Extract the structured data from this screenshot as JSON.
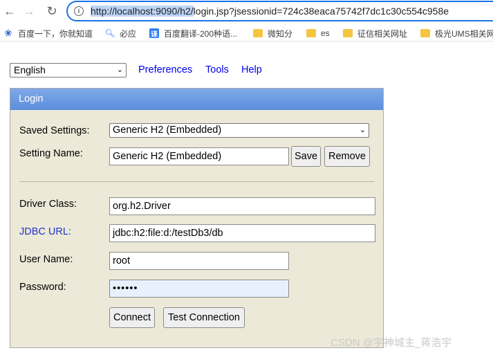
{
  "browser": {
    "url_highlighted": "http://localhost:9090/h2/",
    "url_rest": "login.jsp?jsessionid=724c38eaca75742f7dc1c30c554c958e"
  },
  "bookmarks": [
    {
      "label": "百度一下，你就知道",
      "icon": "baidu-paw-icon"
    },
    {
      "label": "必应",
      "icon": "search-icon"
    },
    {
      "label": "百度翻译-200种语...",
      "icon": "translate-icon"
    },
    {
      "label": "微知分",
      "icon": "folder-icon"
    },
    {
      "label": "es",
      "icon": "folder-icon"
    },
    {
      "label": "征信相关网址",
      "icon": "folder-icon"
    },
    {
      "label": "极光UMS相关网",
      "icon": "folder-icon"
    }
  ],
  "top": {
    "language": "English",
    "preferences": "Preferences",
    "tools": "Tools",
    "help": "Help"
  },
  "login": {
    "header": "Login",
    "saved_settings_label": "Saved Settings:",
    "saved_settings_value": "Generic H2 (Embedded)",
    "setting_name_label": "Setting Name:",
    "setting_name_value": "Generic H2 (Embedded)",
    "save": "Save",
    "remove": "Remove",
    "driver_class_label": "Driver Class:",
    "driver_class_value": "org.h2.Driver",
    "jdbc_url_label": "JDBC URL:",
    "jdbc_url_value": "jdbc:h2:file:d:/testDb3/db",
    "user_name_label": "User Name:",
    "user_name_value": "root",
    "password_label": "Password:",
    "password_value": "••••••",
    "connect": "Connect",
    "test_connection": "Test Connection"
  },
  "watermark": "CSDN @宇神城主_蒋浩宇"
}
